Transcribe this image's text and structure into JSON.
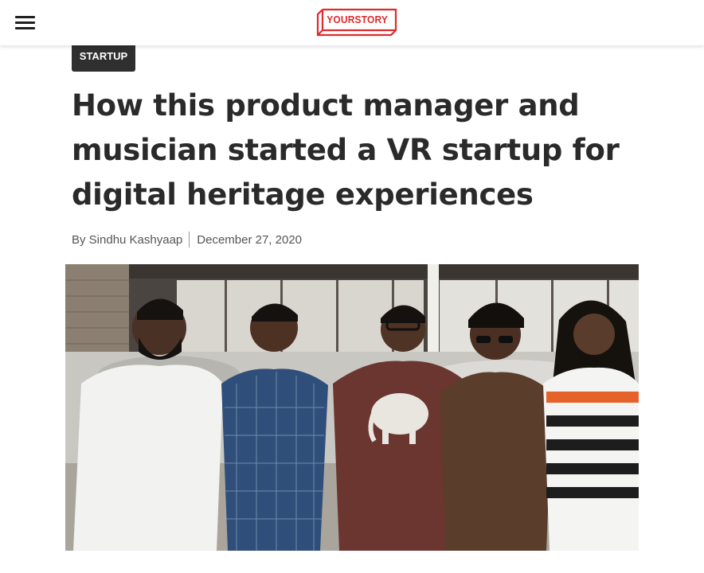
{
  "header": {
    "menu_icon": "hamburger-menu-icon",
    "logo_text": "YOURSTORY",
    "brand_color": "#e02a2a"
  },
  "article": {
    "category": "STARTUP",
    "title": "How this product manager and musician started a VR startup for digital heritage experiences",
    "author": "By Sindhu Kashyaap",
    "date": "December 27, 2020"
  },
  "colors": {
    "tag_background": "#2f2f2f",
    "headline": "#2a2a2a",
    "byline": "#555555"
  }
}
